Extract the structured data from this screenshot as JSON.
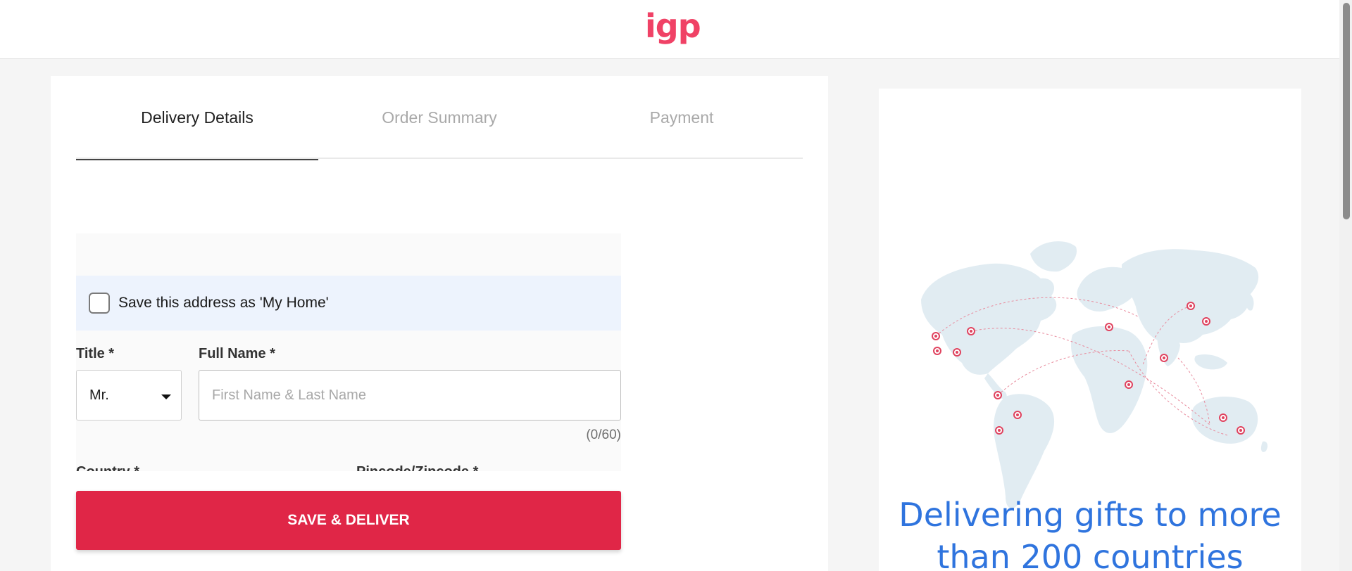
{
  "header": {
    "logo": "igp",
    "brand_color": "#f04266"
  },
  "tabs": [
    {
      "label": "Delivery Details",
      "active": true
    },
    {
      "label": "Order Summary",
      "active": false
    },
    {
      "label": "Payment",
      "active": false
    }
  ],
  "form": {
    "save_address_label": "Save this address as 'My Home'",
    "save_address_checked": false,
    "title_label": "Title *",
    "title_value": "Mr.",
    "full_name_label": "Full Name *",
    "full_name_placeholder": "First Name & Last Name",
    "full_name_value": "",
    "full_name_counter": "(0/60)",
    "country_label": "Country *",
    "pincode_label": "Pincode/Zipcode *"
  },
  "actions": {
    "submit_label": "SAVE & DELIVER",
    "submit_color": "#e02647"
  },
  "promo": {
    "line1": "Delivering gifts to more",
    "line2": "than 200 countries",
    "text_color": "#2f74de"
  },
  "map": {
    "land_color": "#e1ecf2",
    "pin_color": "#e0435f",
    "route_color": "#e88a9c"
  }
}
